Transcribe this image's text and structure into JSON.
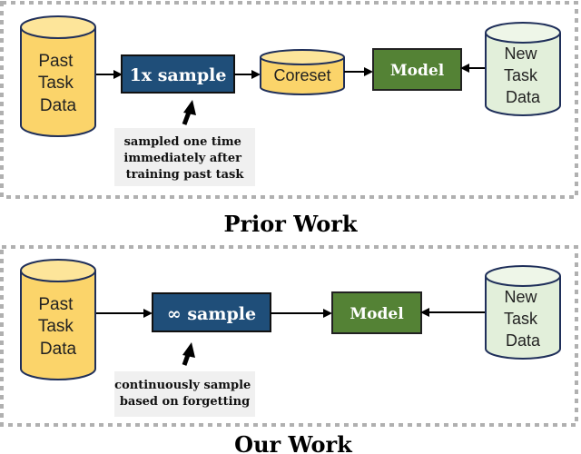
{
  "colors": {
    "past_cylinder_fill": "#fbd46a",
    "past_cylinder_top": "#fde59a",
    "new_cylinder_fill": "#e2efda",
    "new_cylinder_top": "#eef6e8",
    "cylinder_stroke": "#1f2f5a",
    "sample_box_fill": "#1f4e79",
    "model_box_fill": "#548235",
    "note_fill": "#f0f0f0",
    "dashed_border": "#b0b0b0"
  },
  "prior_work": {
    "title": "Prior Work",
    "past_data": [
      "Past",
      "Task",
      "Data"
    ],
    "sample_label": "1x sample",
    "coreset_label": "Coreset",
    "model_label": "Model",
    "new_data": [
      "New",
      "Task",
      "Data"
    ],
    "note": [
      "sampled one time",
      "immediately after",
      "training past task"
    ]
  },
  "our_work": {
    "title": "Our Work",
    "past_data": [
      "Past",
      "Task",
      "Data"
    ],
    "sample_label": "∞ sample",
    "model_label": "Model",
    "new_data": [
      "New",
      "Task",
      "Data"
    ],
    "note": [
      "continuously sample",
      "based on forgetting"
    ]
  }
}
